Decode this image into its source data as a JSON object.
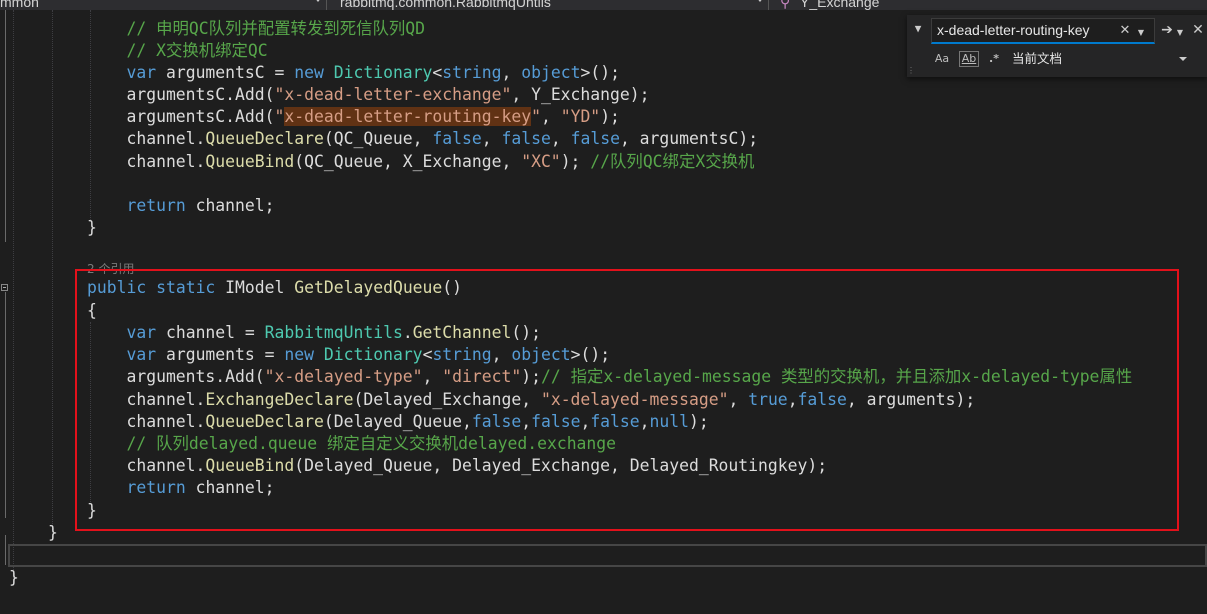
{
  "navbar": {
    "project": "mmon",
    "class": "rabbitmq.common.RabbitmqUntils",
    "member": "Y_Exchange"
  },
  "find": {
    "query": "x-dead-letter-routing-key",
    "scope": "当前文档",
    "match_case_label": "Aa",
    "whole_word_label": "Ab",
    "regex_label": ".*"
  },
  "editor": {
    "codelens": "2 个引用",
    "lines": [
      [
        {
          "t": "    "
        },
        {
          "t": "// 申明QC队列并配置转发到死信队列QD",
          "c": "cm"
        }
      ],
      [
        {
          "t": "    "
        },
        {
          "t": "// X交换机绑定QC",
          "c": "cm"
        }
      ],
      [
        {
          "t": "    "
        },
        {
          "t": "var",
          "c": "kw"
        },
        {
          "t": " argumentsC = "
        },
        {
          "t": "new",
          "c": "kw"
        },
        {
          "t": " "
        },
        {
          "t": "Dictionary",
          "c": "cls"
        },
        {
          "t": "<"
        },
        {
          "t": "string",
          "c": "kw"
        },
        {
          "t": ", "
        },
        {
          "t": "object",
          "c": "kw"
        },
        {
          "t": ">();"
        }
      ],
      [
        {
          "t": "    argumentsC.Add("
        },
        {
          "t": "\"x-dead-letter-exchange\"",
          "c": "str"
        },
        {
          "t": ", Y_Exchange);"
        }
      ],
      [
        {
          "t": "    argumentsC.Add("
        },
        {
          "t": "\"",
          "c": "str"
        },
        {
          "t": "x-dead-letter-routing-key",
          "c": "str hl"
        },
        {
          "t": "\"",
          "c": "str"
        },
        {
          "t": ", "
        },
        {
          "t": "\"YD\"",
          "c": "str"
        },
        {
          "t": ");"
        }
      ],
      [
        {
          "t": "    channel."
        },
        {
          "t": "QueueDeclare",
          "c": "fn"
        },
        {
          "t": "(QC_Queue, "
        },
        {
          "t": "false",
          "c": "kw"
        },
        {
          "t": ", "
        },
        {
          "t": "false",
          "c": "kw"
        },
        {
          "t": ", "
        },
        {
          "t": "false",
          "c": "kw"
        },
        {
          "t": ", argumentsC);"
        }
      ],
      [
        {
          "t": "    channel."
        },
        {
          "t": "QueueBind",
          "c": "fn"
        },
        {
          "t": "(QC_Queue, X_Exchange, "
        },
        {
          "t": "\"XC\"",
          "c": "str"
        },
        {
          "t": "); "
        },
        {
          "t": "//队列QC绑定X交换机",
          "c": "cm"
        }
      ],
      [
        {
          "t": ""
        }
      ],
      [
        {
          "t": "    "
        },
        {
          "t": "return",
          "c": "kw"
        },
        {
          "t": " channel;"
        }
      ],
      [
        {
          "t": "}"
        }
      ],
      [
        {
          "t": ""
        }
      ],
      [
        {
          "t": ""
        }
      ],
      [
        {
          "t": "public",
          "c": "kw"
        },
        {
          "t": " "
        },
        {
          "t": "static",
          "c": "kw"
        },
        {
          "t": " IModel "
        },
        {
          "t": "GetDelayedQueue",
          "c": "fn"
        },
        {
          "t": "()"
        }
      ],
      [
        {
          "t": "{"
        }
      ],
      [
        {
          "t": "    "
        },
        {
          "t": "var",
          "c": "kw"
        },
        {
          "t": " channel = "
        },
        {
          "t": "RabbitmqUntils",
          "c": "cls"
        },
        {
          "t": "."
        },
        {
          "t": "GetChannel",
          "c": "fn"
        },
        {
          "t": "();"
        }
      ],
      [
        {
          "t": "    "
        },
        {
          "t": "var",
          "c": "kw"
        },
        {
          "t": " arguments = "
        },
        {
          "t": "new",
          "c": "kw"
        },
        {
          "t": " "
        },
        {
          "t": "Dictionary",
          "c": "cls"
        },
        {
          "t": "<"
        },
        {
          "t": "string",
          "c": "kw"
        },
        {
          "t": ", "
        },
        {
          "t": "object",
          "c": "kw"
        },
        {
          "t": ">();"
        }
      ],
      [
        {
          "t": "    arguments.Add("
        },
        {
          "t": "\"x-delayed-type\"",
          "c": "str"
        },
        {
          "t": ", "
        },
        {
          "t": "\"direct\"",
          "c": "str"
        },
        {
          "t": ");"
        },
        {
          "t": "// 指定x-delayed-message 类型的交换机，并且添加x-delayed-type属性",
          "c": "cm"
        }
      ],
      [
        {
          "t": "    channel."
        },
        {
          "t": "ExchangeDeclare",
          "c": "fn"
        },
        {
          "t": "(Delayed_Exchange, "
        },
        {
          "t": "\"x-delayed-message\"",
          "c": "str"
        },
        {
          "t": ", "
        },
        {
          "t": "true",
          "c": "kw"
        },
        {
          "t": ","
        },
        {
          "t": "false",
          "c": "kw"
        },
        {
          "t": ", arguments);"
        }
      ],
      [
        {
          "t": "    channel."
        },
        {
          "t": "QueueDeclare",
          "c": "fn"
        },
        {
          "t": "(Delayed_Queue,"
        },
        {
          "t": "false",
          "c": "kw"
        },
        {
          "t": ","
        },
        {
          "t": "false",
          "c": "kw"
        },
        {
          "t": ","
        },
        {
          "t": "false",
          "c": "kw"
        },
        {
          "t": ","
        },
        {
          "t": "null",
          "c": "kw"
        },
        {
          "t": ");"
        }
      ],
      [
        {
          "t": "    "
        },
        {
          "t": "// 队列delayed.queue 绑定自定义交换机delayed.exchange",
          "c": "cm"
        }
      ],
      [
        {
          "t": "    channel."
        },
        {
          "t": "QueueBind",
          "c": "fn"
        },
        {
          "t": "(Delayed_Queue, Delayed_Exchange, Delayed_Routingkey);"
        }
      ],
      [
        {
          "t": "    "
        },
        {
          "t": "return",
          "c": "kw"
        },
        {
          "t": " channel;"
        }
      ],
      [
        {
          "t": "}"
        }
      ],
      [
        {
          "t": "}",
          "indent": "class"
        }
      ],
      [
        {
          "t": ""
        }
      ],
      [
        {
          "t": "}",
          "indent": "ns"
        }
      ]
    ]
  }
}
